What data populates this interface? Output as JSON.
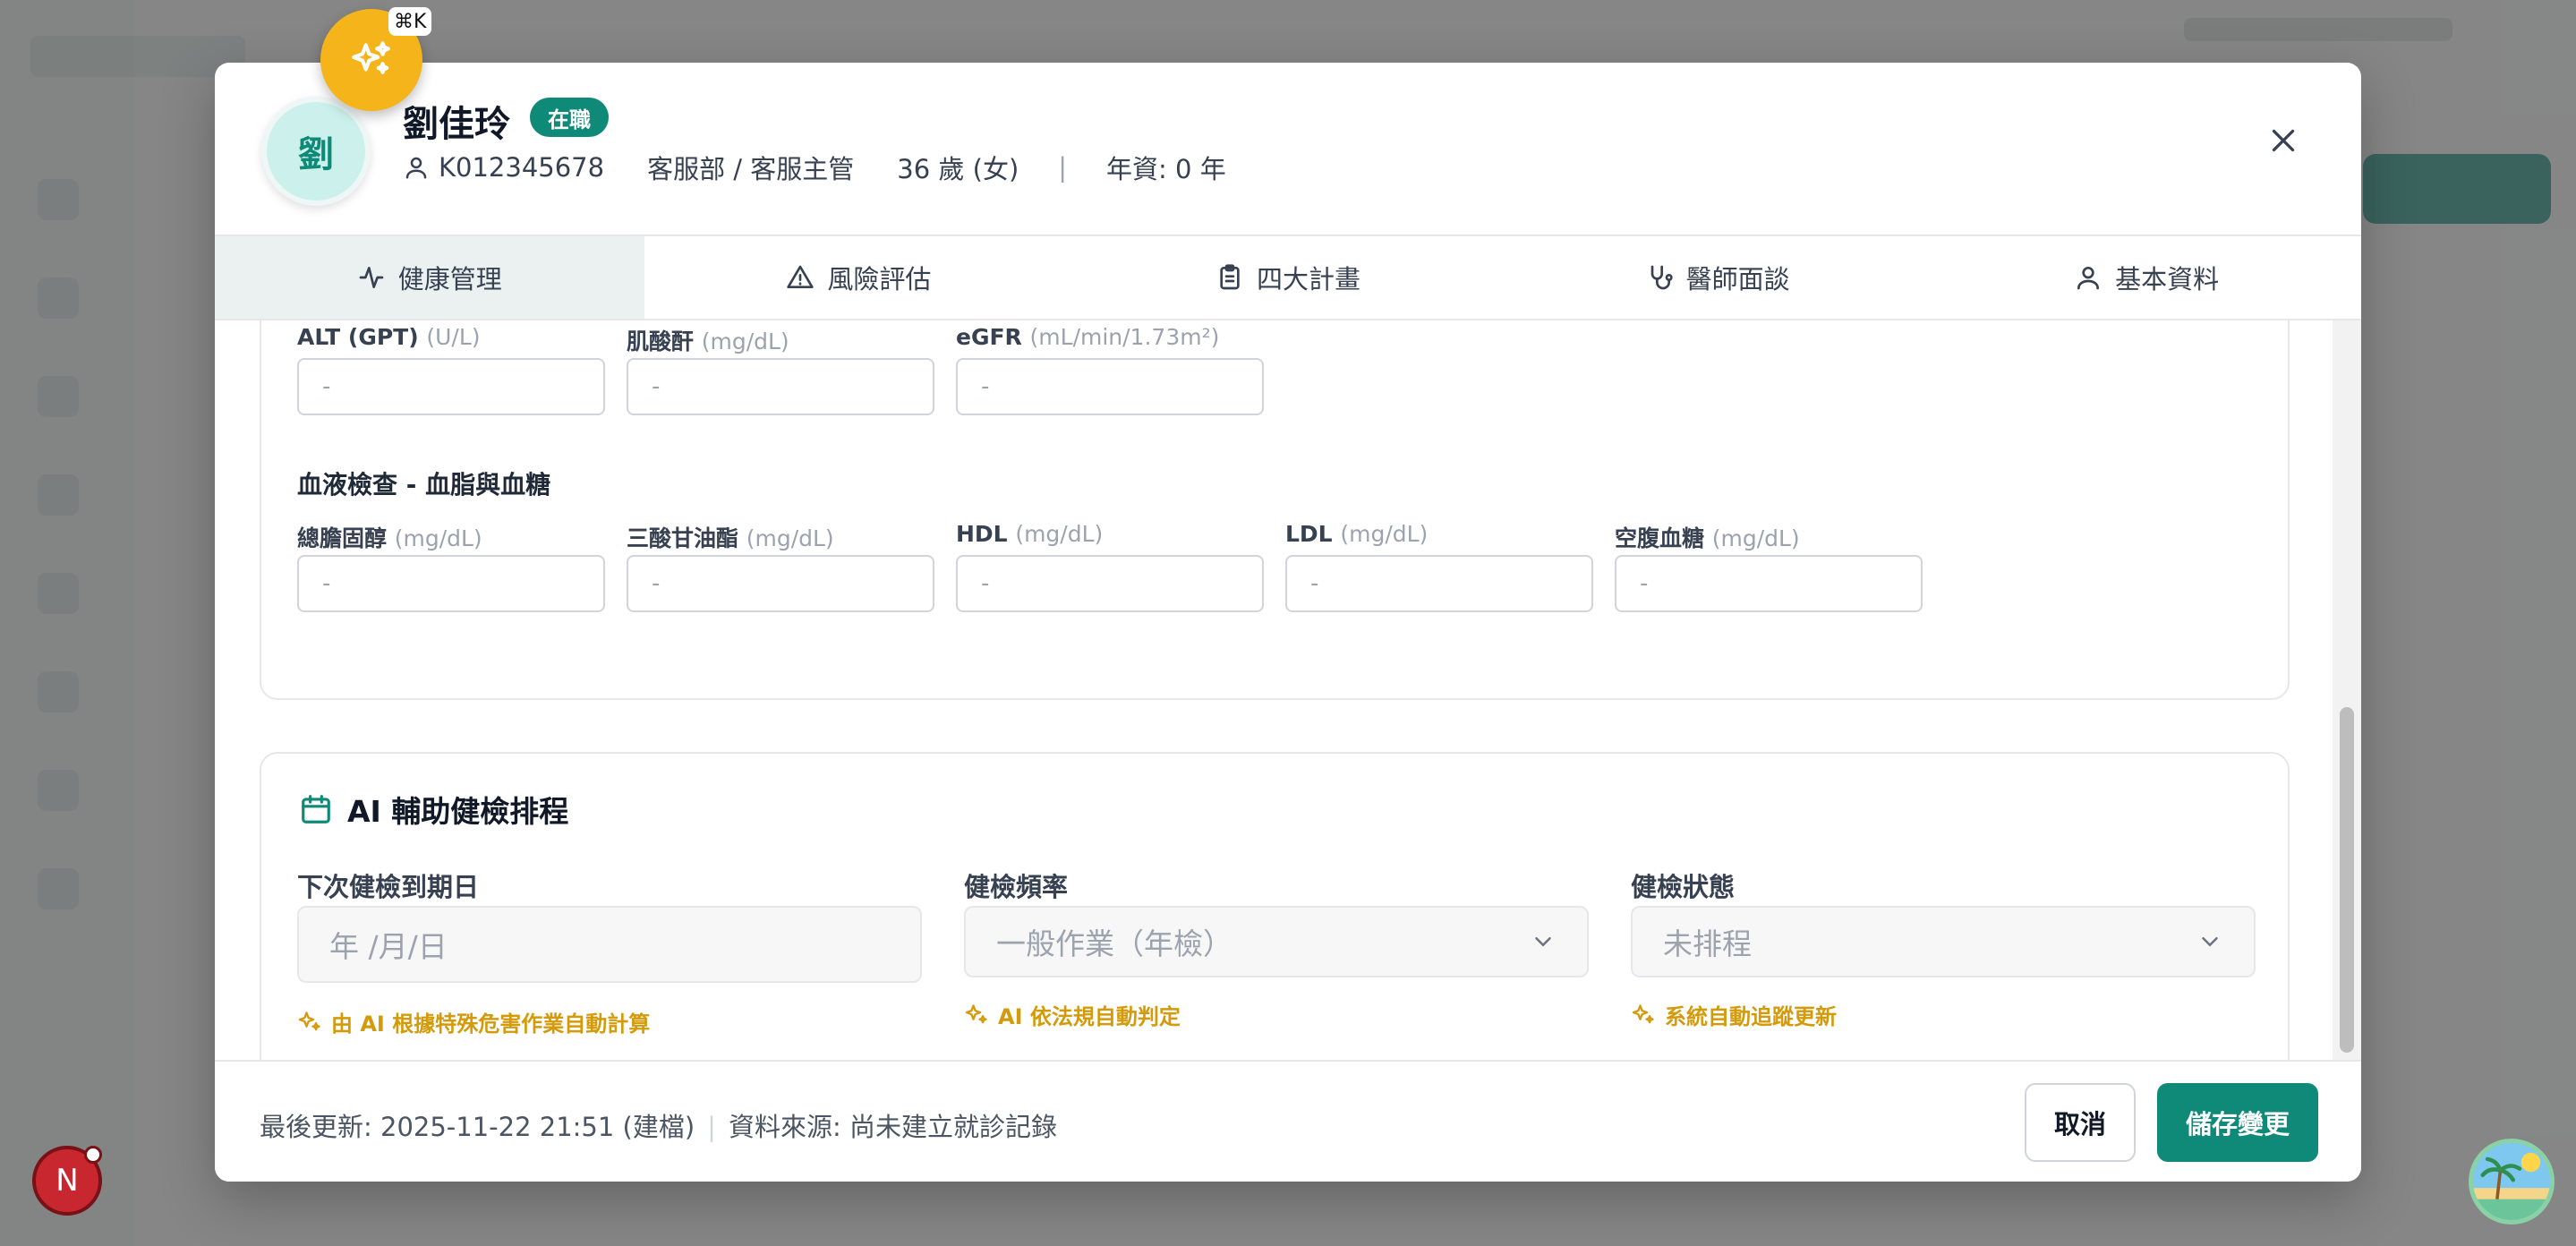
{
  "employee": {
    "avatar_char": "劉",
    "name": "劉佳玲",
    "status": "在職",
    "id": "K012345678",
    "department": "客服部 / 客服主管",
    "age_gender": "36 歲 (女)",
    "separator": "|",
    "tenure": "年資: 0 年"
  },
  "ai_fab": {
    "shortcut": "⌘K"
  },
  "tabs": [
    {
      "label": "健康管理",
      "icon": "activity-icon",
      "active": true
    },
    {
      "label": "風險評估",
      "icon": "warning-triangle-icon",
      "active": false
    },
    {
      "label": "四大計畫",
      "icon": "clipboard-icon",
      "active": false
    },
    {
      "label": "醫師面談",
      "icon": "stethoscope-icon",
      "active": false
    },
    {
      "label": "基本資料",
      "icon": "user-icon",
      "active": false
    }
  ],
  "liver_kidney": {
    "fields": [
      {
        "label": "ALT (GPT)",
        "unit": "(U/L)",
        "value": "-"
      },
      {
        "label": "肌酸酐",
        "unit": "(mg/dL)",
        "value": "-"
      },
      {
        "label": "eGFR",
        "unit": "(mL/min/1.73m²)",
        "value": "-"
      }
    ]
  },
  "lipids": {
    "title": "血液檢查 - 血脂與血糖",
    "fields": [
      {
        "label": "總膽固醇",
        "unit": "(mg/dL)",
        "value": "-"
      },
      {
        "label": "三酸甘油酯",
        "unit": "(mg/dL)",
        "value": "-"
      },
      {
        "label": "HDL",
        "unit": "(mg/dL)",
        "value": "-"
      },
      {
        "label": "LDL",
        "unit": "(mg/dL)",
        "value": "-"
      },
      {
        "label": "空腹血糖",
        "unit": "(mg/dL)",
        "value": "-"
      }
    ]
  },
  "schedule": {
    "title": "AI 輔助健檢排程",
    "next_date": {
      "label": "下次健檢到期日",
      "placeholder": "年 /月/日",
      "hint": "由 AI 根據特殊危害作業自動計算"
    },
    "frequency": {
      "label": "健檢頻率",
      "value": "一般作業（年檢）",
      "hint": "AI 依法規自動判定"
    },
    "status": {
      "label": "健檢狀態",
      "value": "未排程",
      "hint": "系統自動追蹤更新"
    }
  },
  "footer": {
    "last_updated": "最後更新: 2025-11-22 21:51 (建檔)",
    "separator": "|",
    "source": "資料來源: 尚未建立就診記錄",
    "cancel_label": "取消",
    "save_label": "儲存變更"
  },
  "next_badge": "N",
  "colors": {
    "brand": "#0f8a78",
    "ai_accent": "#f4b41a",
    "hint": "#d49a0a"
  }
}
